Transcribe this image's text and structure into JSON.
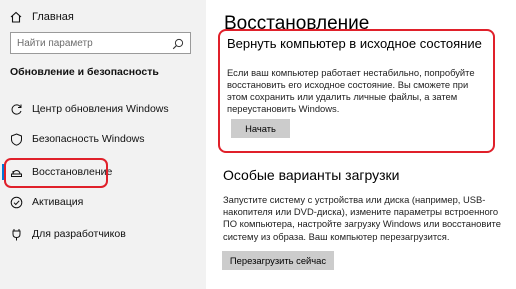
{
  "sidebar": {
    "home_label": "Главная",
    "search_placeholder": "Найти параметр",
    "section_title": "Обновление и безопасность",
    "items": [
      {
        "label": "Центр обновления Windows",
        "icon": "refresh-icon"
      },
      {
        "label": "Безопасность Windows",
        "icon": "shield-icon"
      },
      {
        "label": "Восстановление",
        "icon": "recovery-icon",
        "selected": true
      },
      {
        "label": "Активация",
        "icon": "check-circle-icon"
      },
      {
        "label": "Для разработчиков",
        "icon": "developer-icon"
      }
    ]
  },
  "main": {
    "title": "Восстановление",
    "reset": {
      "heading": "Вернуть компьютер в исходное состояние",
      "description": "Если ваш компьютер работает нестабильно, попробуйте восстановить его исходное состояние. Вы сможете при этом сохранить или удалить личные файлы, а затем переустановить Windows.",
      "button": "Начать"
    },
    "advanced": {
      "heading": "Особые варианты загрузки",
      "description": "Запустите систему с устройства или диска (например, USB-накопителя или DVD-диска), измените параметры встроенного ПО компьютера, настройте загрузку Windows или восстановите систему из образа. Ваш компьютер перезагрузится.",
      "button": "Перезагрузить сейчас"
    }
  },
  "colors": {
    "accent": "#0078d7",
    "highlight": "#e0202a",
    "sidebar_bg": "#f2f2f2",
    "button_bg": "#cccccc"
  }
}
